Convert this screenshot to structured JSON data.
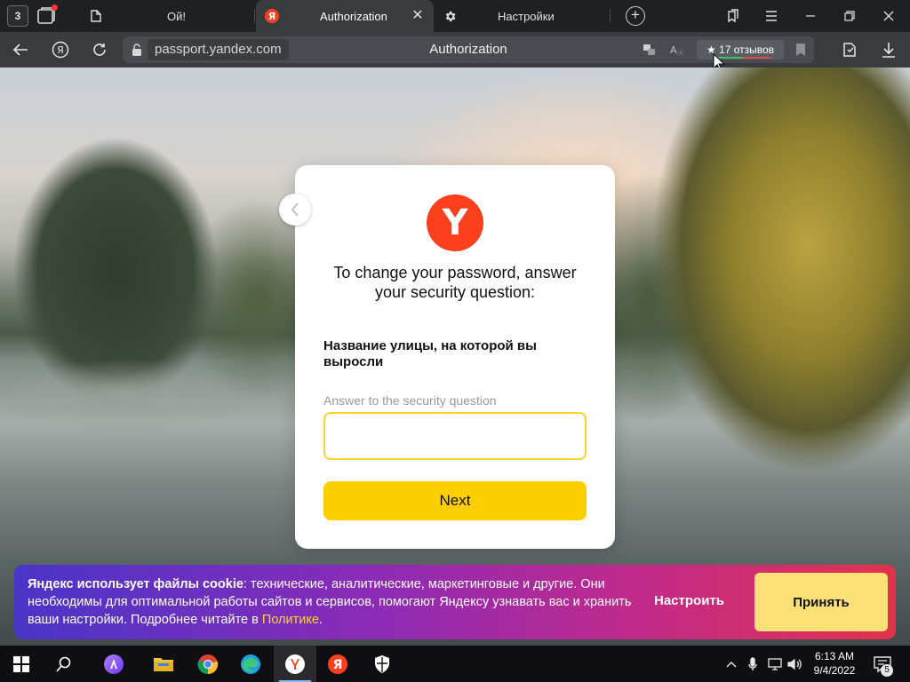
{
  "browser": {
    "tab_count": "3",
    "tabs": [
      {
        "title": "Ой!",
        "icon": "document-icon"
      },
      {
        "title": "Authorization",
        "icon": "yandex-icon",
        "active": true
      },
      {
        "title": "Настройки",
        "icon": "gear-icon"
      }
    ],
    "url": "passport.yandex.com",
    "page_title": "Authorization",
    "reviews_label": "17 отзывов"
  },
  "auth": {
    "logo_letter": "Y",
    "heading_line1": "To change your password, answer",
    "heading_line2": "your security question:",
    "security_question": "Название улицы, на которой вы выросли",
    "answer_label": "Answer to the security question",
    "answer_value": "",
    "next_label": "Next"
  },
  "cookie": {
    "bold_text": "Яндекс использует файлы cookie",
    "body_text": ": технические, аналитические, маркетинговые и другие. Они необходимы для оптимальной работы сайтов и сервисов, помогают Яндексу узнавать вас и хранить ваши настройки. Подробнее читайте в ",
    "link_text": "Политике",
    "end_text": ".",
    "configure_label": "Настроить",
    "accept_label": "Принять"
  },
  "taskbar": {
    "time": "6:13 AM",
    "date": "9/4/2022",
    "notification_count": "5"
  },
  "colors": {
    "yandex_red": "#fc3f1d",
    "yandex_yellow": "#fdcf00",
    "accept_yellow": "#fee176"
  }
}
